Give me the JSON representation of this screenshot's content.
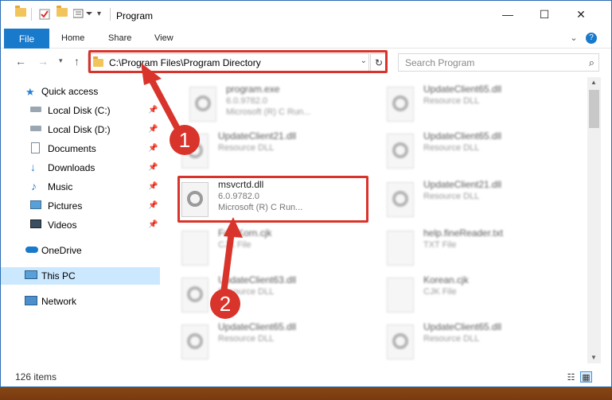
{
  "window": {
    "title": "Program",
    "controls": [
      "minimize",
      "maximize",
      "close"
    ]
  },
  "ribbon": {
    "tabs": [
      "File",
      "Home",
      "Share",
      "View"
    ]
  },
  "address_bar": {
    "path": "C:\\Program Files\\Program Directory"
  },
  "search": {
    "placeholder": "Search Program"
  },
  "sidebar": {
    "items": [
      {
        "label": "Quick access",
        "icon": "star-icon",
        "pinned": false
      },
      {
        "label": "Local Disk (C:)",
        "icon": "drive-icon",
        "pinned": true
      },
      {
        "label": "Local Disk (D:)",
        "icon": "drive-icon",
        "pinned": true
      },
      {
        "label": "Documents",
        "icon": "documents-icon",
        "pinned": true
      },
      {
        "label": "Downloads",
        "icon": "download-icon",
        "pinned": true
      },
      {
        "label": "Music",
        "icon": "music-icon",
        "pinned": true
      },
      {
        "label": "Pictures",
        "icon": "pictures-icon",
        "pinned": true
      },
      {
        "label": "Videos",
        "icon": "videos-icon",
        "pinned": true
      },
      {
        "label": "OneDrive",
        "icon": "cloud-icon",
        "pinned": false
      },
      {
        "label": "This PC",
        "icon": "computer-icon",
        "pinned": false,
        "selected": true
      },
      {
        "label": "Network",
        "icon": "network-icon",
        "pinned": false
      }
    ]
  },
  "files": [
    {
      "name": "program.exe",
      "line2": "6.0.9782.0",
      "line3": "Microsoft (R) C Run...",
      "blurred": true
    },
    {
      "name": "UpdateClient65.dll",
      "line2": "Resource DLL",
      "line3": "",
      "blurred": true
    },
    {
      "name": "UpdateClient21.dll",
      "line2": "Resource DLL",
      "line3": "",
      "blurred": true
    },
    {
      "name": "UpdateClient65.dll",
      "line2": "Resource DLL",
      "line3": "",
      "blurred": true
    },
    {
      "name": "msvcrtd.dll",
      "line2": "6.0.9782.0",
      "line3": "Microsoft (R) C Run...",
      "blurred": false
    },
    {
      "name": "UpdateClient21.dll",
      "line2": "Resource DLL",
      "line3": "",
      "blurred": true
    },
    {
      "name": "FontKorn.cjk",
      "line2": "CJK File",
      "line3": "",
      "blurred": true
    },
    {
      "name": "help.fineReader.txt",
      "line2": "TXT File",
      "line3": "",
      "blurred": true
    },
    {
      "name": "UpdateClient63.dll",
      "line2": "Resource DLL",
      "line3": "",
      "blurred": true
    },
    {
      "name": "Korean.cjk",
      "line2": "CJK File",
      "line3": "",
      "blurred": true
    },
    {
      "name": "UpdateClient65.dll",
      "line2": "Resource DLL",
      "line3": "",
      "blurred": true
    },
    {
      "name": "UpdateClient65.dll",
      "line2": "Resource DLL",
      "line3": "",
      "blurred": true
    }
  ],
  "status": {
    "item_count": "126 items"
  },
  "annotations": [
    {
      "label": "1"
    },
    {
      "label": "2"
    }
  ],
  "colors": {
    "accent": "#1979ca",
    "highlight": "#d9342b",
    "selected_bg": "#cce8ff"
  }
}
